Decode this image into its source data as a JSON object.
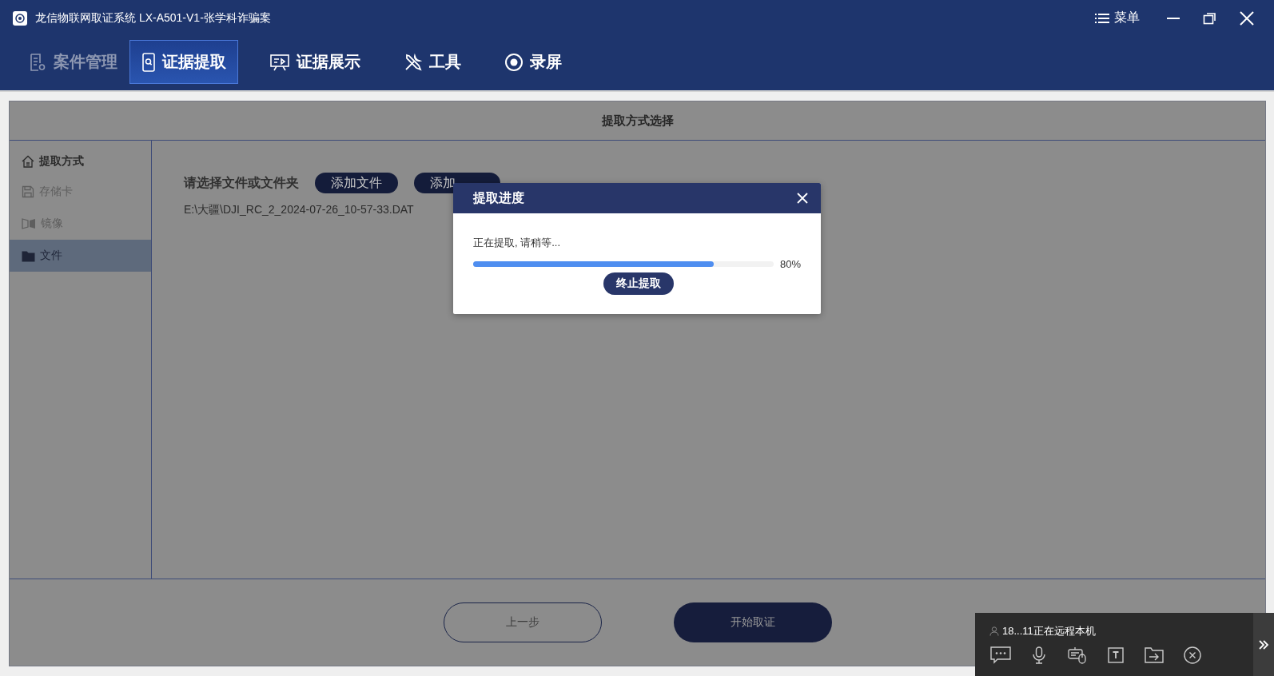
{
  "window": {
    "title": "龙信物联网取证系统 LX-A501-V1-张学科诈骗案",
    "menu_label": "菜单"
  },
  "nav_tabs": [
    {
      "label": "案件管理",
      "kind": "case",
      "selected": false,
      "disabled": true
    },
    {
      "label": "证据提取",
      "kind": "extract",
      "selected": true,
      "disabled": false
    },
    {
      "label": "证据展示",
      "kind": "display",
      "selected": false,
      "disabled": false
    },
    {
      "label": "工具",
      "kind": "tools",
      "selected": false,
      "disabled": false
    },
    {
      "label": "录屏",
      "kind": "record",
      "selected": false,
      "disabled": false
    }
  ],
  "panel": {
    "title": "提取方式选择",
    "sidebar": {
      "heading": "提取方式",
      "items": [
        {
          "label": "存储卡",
          "kind": "card",
          "selected": false
        },
        {
          "label": "镜像",
          "kind": "image",
          "selected": false
        },
        {
          "label": "文件",
          "kind": "file",
          "selected": true
        }
      ]
    },
    "prompt": "请选择文件或文件夹",
    "buttons": [
      "添加文件",
      "添加"
    ],
    "files": [
      "E:\\大疆\\DJI_RC_2_2024-07-26_10-57-33.DAT"
    ],
    "footer_buttons": [
      {
        "label": "上一步",
        "kind": "outline"
      },
      {
        "label": "开始取证",
        "kind": "filled"
      }
    ]
  },
  "dialog": {
    "title": "提取进度",
    "message": "正在提取, 请稍等...",
    "level": 0.8,
    "reading": "80%",
    "button": "终止提取"
  },
  "remote": {
    "status": "18...11正在远程本机"
  }
}
